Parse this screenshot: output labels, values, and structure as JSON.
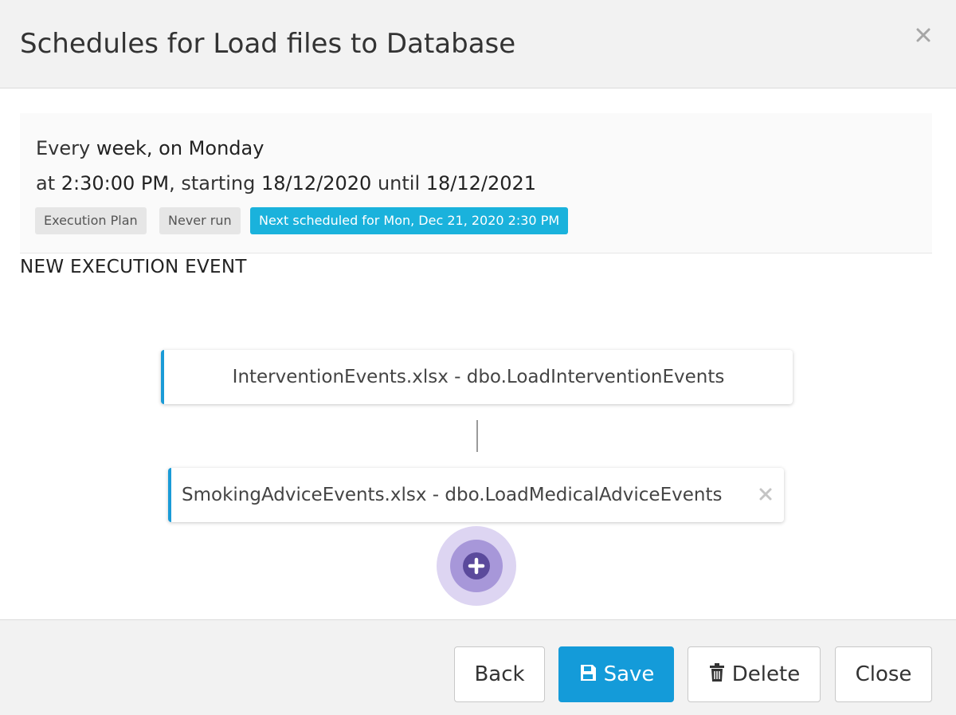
{
  "modal": {
    "title": "Schedules for Load files to Database"
  },
  "summary": {
    "line1_prefix": "Every ",
    "line1_bold": "week, on Monday",
    "line2_prefix": "at ",
    "line2_time": "2:30:00 PM",
    "line2_mid": ", starting ",
    "line2_start": "18/12/2020",
    "line2_until": " until ",
    "line2_end": "18/12/2021",
    "badges": {
      "plan": "Execution Plan",
      "status": "Never run",
      "next": "Next scheduled for Mon, Dec 21, 2020 2:30 PM"
    }
  },
  "section": {
    "title": "NEW EXECUTION EVENT"
  },
  "flow": {
    "nodes": [
      {
        "label": "InterventionEvents.xlsx - dbo.LoadInterventionEvents"
      },
      {
        "label": "SmokingAdviceEvents.xlsx - dbo.LoadMedicalAdviceEvents"
      }
    ]
  },
  "footer": {
    "back": "Back",
    "save": "Save",
    "delete": "Delete",
    "close": "Close"
  },
  "colors": {
    "accent": "#149bd9",
    "badge_next": "#1ab2dc",
    "add_button": "#5b4a9c",
    "node_border": "#1a9bd7"
  },
  "icons": {
    "close": "close-icon",
    "remove": "remove-icon",
    "add": "plus-circle-icon",
    "save": "floppy-disk-icon",
    "delete": "trash-icon"
  }
}
